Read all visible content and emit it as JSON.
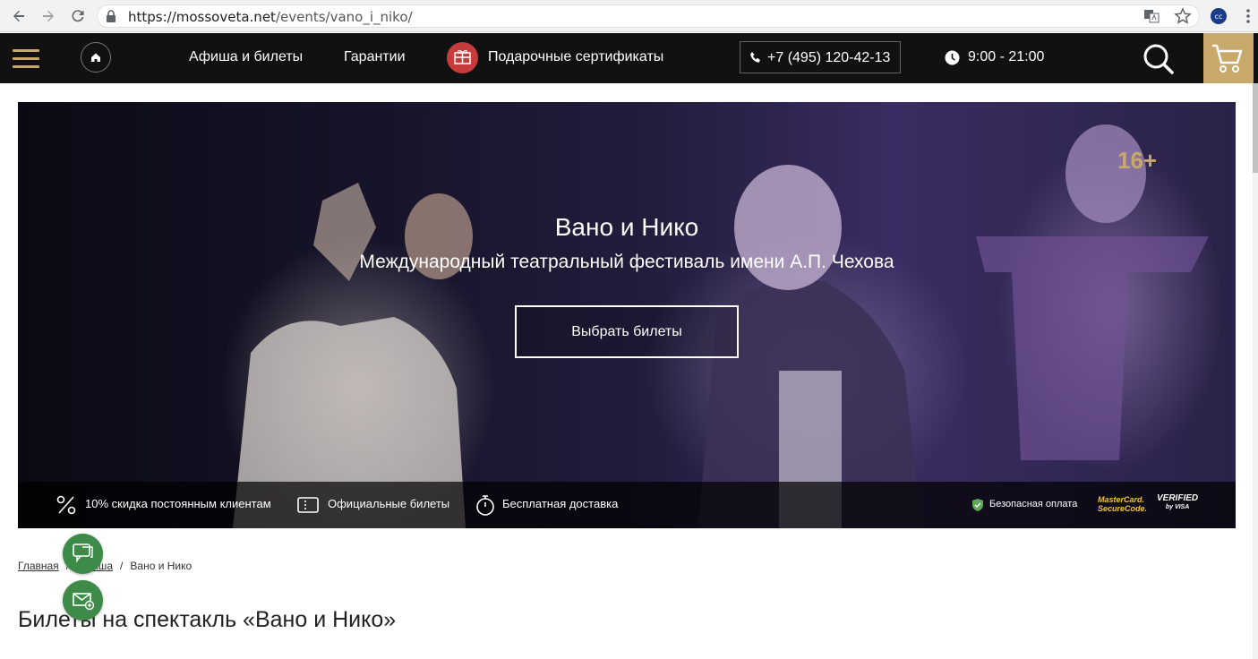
{
  "browser": {
    "url_domain": "https://mossoveta.net",
    "url_path": "/events/vano_i_niko/",
    "back_icon": "arrow-left-icon",
    "forward_icon": "arrow-right-icon",
    "reload_icon": "reload-icon"
  },
  "header": {
    "menu": [
      "Афиша и билеты",
      "Гарантии",
      "Подарочные сертификаты"
    ],
    "phone": "+7 (495) 120-42-13",
    "hours": "9:00 - 21:00",
    "accent_color": "#c9a96b"
  },
  "hero": {
    "age": "16+",
    "title": "Вано и Нико",
    "subtitle": "Международный театральный фестиваль имени А.П. Чехова",
    "cta": "Выбрать билеты",
    "features": [
      "10% скидка постоянным клиентам",
      "Официальные билеты",
      "Бесплатная доставка"
    ],
    "secure_payment": "Безопасная оплата",
    "mastercard_line1": "MasterCard.",
    "mastercard_line2": "SecureCode.",
    "visa_line1": "VERIFIED",
    "visa_line2": "by VISA"
  },
  "breadcrumb": {
    "home": "Главная",
    "afisha": "Афиша",
    "current": "Вано и Нико",
    "separator": "/"
  },
  "page_title": "Билеты на спектакль «Вано и Нико»",
  "fab_color": "#3e8a48"
}
